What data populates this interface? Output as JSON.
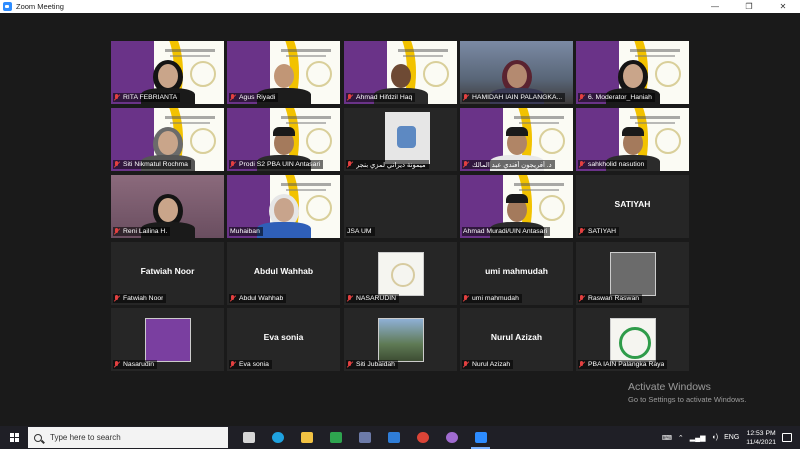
{
  "window": {
    "title": "Zoom Meeting",
    "controls": [
      "—",
      "❐",
      "✕"
    ]
  },
  "participants": [
    {
      "name": "RITA FEBRIANTA",
      "muted": true,
      "video": "slide",
      "figure": "hijab-black",
      "active": true
    },
    {
      "name": "Agus Riyadi",
      "muted": true,
      "video": "slide",
      "figure": "man-black"
    },
    {
      "name": "Ahmad Hifdzil Haq",
      "muted": true,
      "video": "slide",
      "figure": "man-dark"
    },
    {
      "name": "HAMIDAH IAIN PALANGKA...",
      "muted": true,
      "video": "outdoor",
      "figure": "hijab-maroon"
    },
    {
      "name": "6. Moderator_Haniah",
      "muted": true,
      "video": "slide",
      "figure": "hijab-black"
    },
    {
      "name": "Siti Nikmatul Rochma",
      "muted": true,
      "video": "slide",
      "figure": "hijab-grey"
    },
    {
      "name": "Prodi S2 PBA UIN Antasari",
      "muted": true,
      "video": "slide",
      "figure": "man-cap"
    },
    {
      "name": "ميمونة ديراني لمزي بنجر",
      "muted": true,
      "video": "chat",
      "figure": "none"
    },
    {
      "name": "د. أفريجون أفندي عبد المالك",
      "muted": true,
      "video": "slide",
      "figure": "man-white"
    },
    {
      "name": "sahkholid nasution",
      "muted": true,
      "video": "slide",
      "figure": "man-cap"
    },
    {
      "name": "Reni Lailina H.",
      "muted": true,
      "video": "room",
      "figure": "hijab-black"
    },
    {
      "name": "Muhaiban",
      "muted": false,
      "video": "slide",
      "figure": "man-old"
    },
    {
      "name": "JSA UM",
      "muted": false,
      "video": "dark",
      "figure": "none"
    },
    {
      "name": "Ahmad Muradi/UIN Antasari",
      "muted": false,
      "video": "slide",
      "figure": "man-cap"
    },
    {
      "name": "SATIYAH",
      "muted": true,
      "video": "namecard",
      "display": "SATIYAH"
    },
    {
      "name": "Fatwiah Noor",
      "muted": true,
      "video": "namecard",
      "display": "Fatwiah Noor"
    },
    {
      "name": "Abdul Wahhab",
      "muted": true,
      "video": "namecard",
      "display": "Abdul Wahhab"
    },
    {
      "name": "NASARUDIN",
      "muted": true,
      "video": "picture",
      "picture": "logo"
    },
    {
      "name": "umi mahmudah",
      "muted": true,
      "video": "namecard",
      "display": "umi mahmudah"
    },
    {
      "name": "Raswan Raswan",
      "muted": true,
      "video": "picture",
      "picture": "photo"
    },
    {
      "name": "Nasarudin",
      "muted": true,
      "video": "picture",
      "picture": "purple"
    },
    {
      "name": "Eva sonia",
      "muted": true,
      "video": "namecard",
      "display": "Eva sonia"
    },
    {
      "name": "Siti Jubaidah",
      "muted": true,
      "video": "picture",
      "picture": "outdoor"
    },
    {
      "name": "Nurul Azizah",
      "muted": true,
      "video": "namecard",
      "display": "Nurul Azizah"
    },
    {
      "name": "PBA IAIN Palangka Raya",
      "muted": true,
      "video": "picture",
      "picture": "green"
    }
  ],
  "watermark": {
    "line1": "Activate Windows",
    "line2": "Go to Settings to activate Windows."
  },
  "taskbar": {
    "search_placeholder": "Type here to search",
    "apps": [
      {
        "name": "task-view",
        "color": "#d6d6d6"
      },
      {
        "name": "edge",
        "color": "#1fa2e0"
      },
      {
        "name": "file-explorer",
        "color": "#f2c243"
      },
      {
        "name": "sheets",
        "color": "#2ea44f"
      },
      {
        "name": "store",
        "color": "#6c7aa8"
      },
      {
        "name": "mail",
        "color": "#2f7dd8"
      },
      {
        "name": "chrome",
        "color": "#db4437"
      },
      {
        "name": "media",
        "color": "#a06bd0"
      },
      {
        "name": "zoom",
        "color": "#2d8cff",
        "active": true
      }
    ],
    "tray": {
      "language": "ENG",
      "time": "12:53 PM",
      "date": "11/4/2021"
    }
  },
  "colors": {
    "background": "#1a1a1a",
    "tile": "#262626",
    "active_speaker": "#e8e84a",
    "muted_icon": "#e34040",
    "slide_purple": "#6a3388",
    "slide_yellow": "#f2c200",
    "taskbar": "#1f1f26"
  }
}
